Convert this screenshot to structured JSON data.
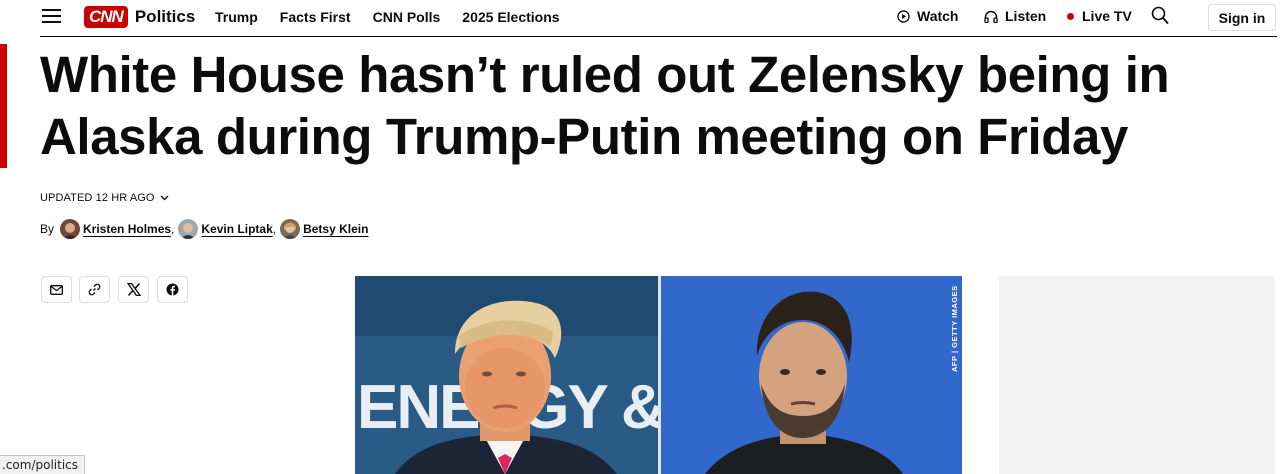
{
  "header": {
    "logo_text": "CNN",
    "section": "Politics",
    "nav": [
      "Trump",
      "Facts First",
      "CNN Polls",
      "2025 Elections"
    ],
    "watch": "Watch",
    "listen": "Listen",
    "live_tv": "Live TV",
    "sign_in": "Sign in"
  },
  "article": {
    "headline": "White House hasn’t ruled out Zelensky being in Alaska during Trump-Putin meeting on Friday",
    "updated": "UPDATED 12 HR AGO",
    "by": "By",
    "authors": [
      "Kristen Holmes",
      "Kevin Liptak",
      "Betsy Klein"
    ],
    "image_credit": "AFP | GETTY IMAGES",
    "backdrop_text": "ENERGY &"
  },
  "share": [
    "email-icon",
    "link-icon",
    "x-icon",
    "facebook-icon"
  ],
  "status_url": ".com/politics",
  "colors": {
    "brand_red": "#cc0000",
    "text": "#0c0c0c",
    "left_photo_bg": "#2a5b86",
    "right_photo_bg": "#2f63c8"
  }
}
